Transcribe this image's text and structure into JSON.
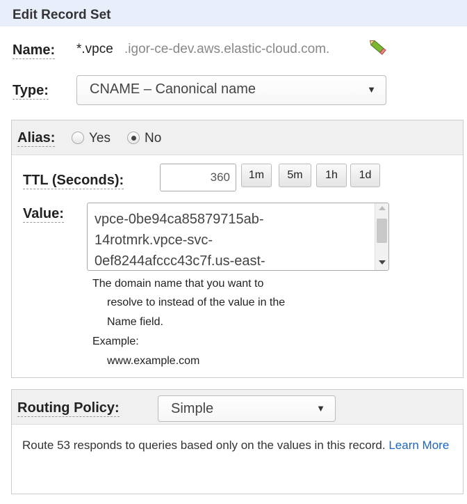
{
  "header": {
    "title": "Edit Record Set"
  },
  "name": {
    "label": "Name:",
    "prefix": "*.vpce",
    "domain": ".igor-ce-dev.aws.elastic-cloud.com.",
    "edit_icon": "pencil-icon"
  },
  "type": {
    "label": "Type:",
    "selected": "CNAME – Canonical name"
  },
  "alias": {
    "label": "Alias:",
    "options": [
      {
        "label": "Yes",
        "checked": false
      },
      {
        "label": "No",
        "checked": true
      }
    ]
  },
  "ttl": {
    "label": "TTL (Seconds):",
    "value": "360",
    "presets": [
      "1m",
      "5m",
      "1h",
      "1d"
    ]
  },
  "value": {
    "label": "Value:",
    "lines": [
      "vpce-0be94ca85879715ab-",
      "14rotmrk.vpce-svc-",
      "0ef8244afccc43c7f.us-east-"
    ],
    "help": [
      "The domain name that you want to",
      "resolve to instead of the value in the",
      "Name field.",
      "Example:",
      "www.example.com"
    ]
  },
  "routing": {
    "label": "Routing Policy:",
    "selected": "Simple",
    "description": "Route 53 responds to queries based only on the values in this record.",
    "learn_more": "Learn More"
  },
  "colors": {
    "header_bg": "#e8effb",
    "link": "#1a66c2",
    "pencil": "#6aa12a"
  }
}
